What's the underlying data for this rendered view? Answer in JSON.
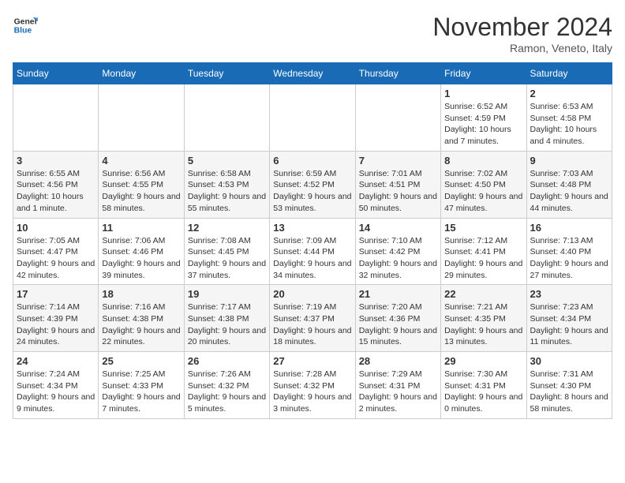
{
  "logo": {
    "line1": "General",
    "line2": "Blue"
  },
  "title": "November 2024",
  "location": "Ramon, Veneto, Italy",
  "days_of_week": [
    "Sunday",
    "Monday",
    "Tuesday",
    "Wednesday",
    "Thursday",
    "Friday",
    "Saturday"
  ],
  "weeks": [
    [
      {
        "day": "",
        "info": ""
      },
      {
        "day": "",
        "info": ""
      },
      {
        "day": "",
        "info": ""
      },
      {
        "day": "",
        "info": ""
      },
      {
        "day": "",
        "info": ""
      },
      {
        "day": "1",
        "info": "Sunrise: 6:52 AM\nSunset: 4:59 PM\nDaylight: 10 hours and 7 minutes."
      },
      {
        "day": "2",
        "info": "Sunrise: 6:53 AM\nSunset: 4:58 PM\nDaylight: 10 hours and 4 minutes."
      }
    ],
    [
      {
        "day": "3",
        "info": "Sunrise: 6:55 AM\nSunset: 4:56 PM\nDaylight: 10 hours and 1 minute."
      },
      {
        "day": "4",
        "info": "Sunrise: 6:56 AM\nSunset: 4:55 PM\nDaylight: 9 hours and 58 minutes."
      },
      {
        "day": "5",
        "info": "Sunrise: 6:58 AM\nSunset: 4:53 PM\nDaylight: 9 hours and 55 minutes."
      },
      {
        "day": "6",
        "info": "Sunrise: 6:59 AM\nSunset: 4:52 PM\nDaylight: 9 hours and 53 minutes."
      },
      {
        "day": "7",
        "info": "Sunrise: 7:01 AM\nSunset: 4:51 PM\nDaylight: 9 hours and 50 minutes."
      },
      {
        "day": "8",
        "info": "Sunrise: 7:02 AM\nSunset: 4:50 PM\nDaylight: 9 hours and 47 minutes."
      },
      {
        "day": "9",
        "info": "Sunrise: 7:03 AM\nSunset: 4:48 PM\nDaylight: 9 hours and 44 minutes."
      }
    ],
    [
      {
        "day": "10",
        "info": "Sunrise: 7:05 AM\nSunset: 4:47 PM\nDaylight: 9 hours and 42 minutes."
      },
      {
        "day": "11",
        "info": "Sunrise: 7:06 AM\nSunset: 4:46 PM\nDaylight: 9 hours and 39 minutes."
      },
      {
        "day": "12",
        "info": "Sunrise: 7:08 AM\nSunset: 4:45 PM\nDaylight: 9 hours and 37 minutes."
      },
      {
        "day": "13",
        "info": "Sunrise: 7:09 AM\nSunset: 4:44 PM\nDaylight: 9 hours and 34 minutes."
      },
      {
        "day": "14",
        "info": "Sunrise: 7:10 AM\nSunset: 4:42 PM\nDaylight: 9 hours and 32 minutes."
      },
      {
        "day": "15",
        "info": "Sunrise: 7:12 AM\nSunset: 4:41 PM\nDaylight: 9 hours and 29 minutes."
      },
      {
        "day": "16",
        "info": "Sunrise: 7:13 AM\nSunset: 4:40 PM\nDaylight: 9 hours and 27 minutes."
      }
    ],
    [
      {
        "day": "17",
        "info": "Sunrise: 7:14 AM\nSunset: 4:39 PM\nDaylight: 9 hours and 24 minutes."
      },
      {
        "day": "18",
        "info": "Sunrise: 7:16 AM\nSunset: 4:38 PM\nDaylight: 9 hours and 22 minutes."
      },
      {
        "day": "19",
        "info": "Sunrise: 7:17 AM\nSunset: 4:38 PM\nDaylight: 9 hours and 20 minutes."
      },
      {
        "day": "20",
        "info": "Sunrise: 7:19 AM\nSunset: 4:37 PM\nDaylight: 9 hours and 18 minutes."
      },
      {
        "day": "21",
        "info": "Sunrise: 7:20 AM\nSunset: 4:36 PM\nDaylight: 9 hours and 15 minutes."
      },
      {
        "day": "22",
        "info": "Sunrise: 7:21 AM\nSunset: 4:35 PM\nDaylight: 9 hours and 13 minutes."
      },
      {
        "day": "23",
        "info": "Sunrise: 7:23 AM\nSunset: 4:34 PM\nDaylight: 9 hours and 11 minutes."
      }
    ],
    [
      {
        "day": "24",
        "info": "Sunrise: 7:24 AM\nSunset: 4:34 PM\nDaylight: 9 hours and 9 minutes."
      },
      {
        "day": "25",
        "info": "Sunrise: 7:25 AM\nSunset: 4:33 PM\nDaylight: 9 hours and 7 minutes."
      },
      {
        "day": "26",
        "info": "Sunrise: 7:26 AM\nSunset: 4:32 PM\nDaylight: 9 hours and 5 minutes."
      },
      {
        "day": "27",
        "info": "Sunrise: 7:28 AM\nSunset: 4:32 PM\nDaylight: 9 hours and 3 minutes."
      },
      {
        "day": "28",
        "info": "Sunrise: 7:29 AM\nSunset: 4:31 PM\nDaylight: 9 hours and 2 minutes."
      },
      {
        "day": "29",
        "info": "Sunrise: 7:30 AM\nSunset: 4:31 PM\nDaylight: 9 hours and 0 minutes."
      },
      {
        "day": "30",
        "info": "Sunrise: 7:31 AM\nSunset: 4:30 PM\nDaylight: 8 hours and 58 minutes."
      }
    ]
  ]
}
